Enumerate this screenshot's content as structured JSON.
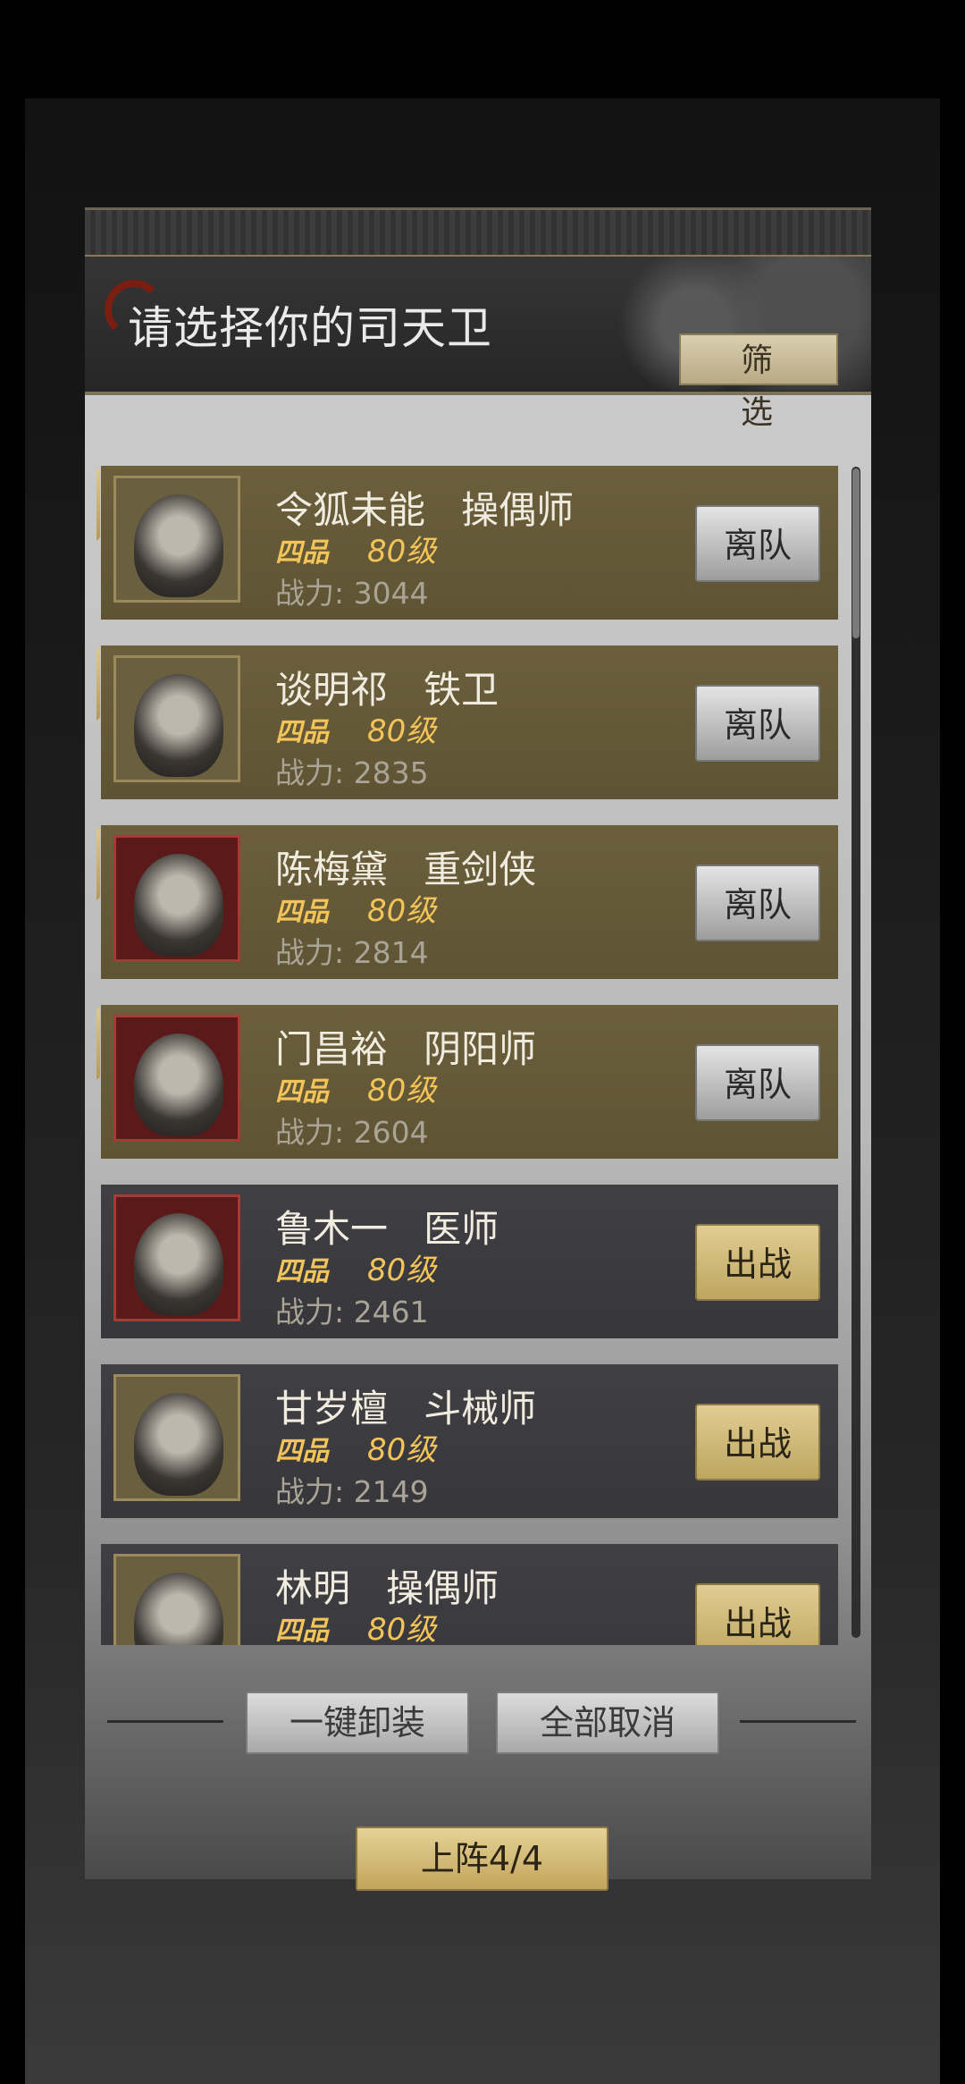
{
  "header": {
    "title": "请选择你的司天卫",
    "filter_label": "筛 选"
  },
  "roster": [
    {
      "slot": "1",
      "name": "令狐未能",
      "class": "操偶师",
      "grade": "四品",
      "level": "80级",
      "power_label": "战力:",
      "power": "3044",
      "selected": true,
      "action": "离队",
      "frame": "gold"
    },
    {
      "slot": "2",
      "name": "谈明祁",
      "class": "铁卫",
      "grade": "四品",
      "level": "80级",
      "power_label": "战力:",
      "power": "2835",
      "selected": true,
      "action": "离队",
      "frame": "gold"
    },
    {
      "slot": "3",
      "name": "陈梅黛",
      "class": "重剑侠",
      "grade": "四品",
      "level": "80级",
      "power_label": "战力:",
      "power": "2814",
      "selected": true,
      "action": "离队",
      "frame": "red"
    },
    {
      "slot": "4",
      "name": "门昌裕",
      "class": "阴阳师",
      "grade": "四品",
      "level": "80级",
      "power_label": "战力:",
      "power": "2604",
      "selected": true,
      "action": "离队",
      "frame": "red"
    },
    {
      "slot": "",
      "name": "鲁木一",
      "class": "医师",
      "grade": "四品",
      "level": "80级",
      "power_label": "战力:",
      "power": "2461",
      "selected": false,
      "action": "出战",
      "frame": "red"
    },
    {
      "slot": "",
      "name": "甘岁檀",
      "class": "斗械师",
      "grade": "四品",
      "level": "80级",
      "power_label": "战力:",
      "power": "2149",
      "selected": false,
      "action": "出战",
      "frame": "gold"
    },
    {
      "slot": "",
      "name": "林明",
      "class": "操偶师",
      "grade": "四品",
      "level": "80级",
      "power_label": "",
      "power": "",
      "selected": false,
      "action": "出战",
      "frame": "gold"
    }
  ],
  "footer": {
    "unequip_all": "一键卸装",
    "cancel_all": "全部取消",
    "deploy": "上阵4/4"
  },
  "colors": {
    "selected_row": "#6b5f3c",
    "normal_row": "#3f3f44",
    "accent_gold": "#f2c45a"
  }
}
